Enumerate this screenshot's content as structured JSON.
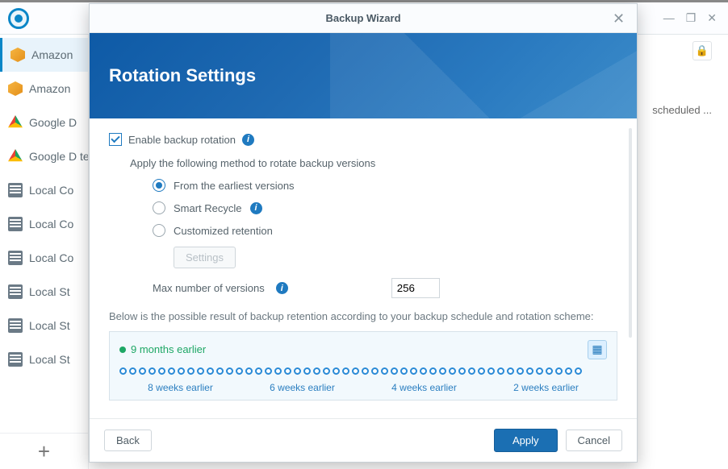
{
  "window": {
    "controls": {
      "min": "—",
      "max": "❐",
      "close": "✕"
    }
  },
  "sidebar": {
    "items": [
      {
        "label": "Amazon",
        "icon": "cube"
      },
      {
        "label": "Amazon",
        "icon": "cube"
      },
      {
        "label": "Google D",
        "icon": "drive"
      },
      {
        "label": "Google D test",
        "icon": "drive"
      },
      {
        "label": "Local Co",
        "icon": "db"
      },
      {
        "label": "Local Co",
        "icon": "db"
      },
      {
        "label": "Local Co",
        "icon": "db"
      },
      {
        "label": "Local St",
        "icon": "db"
      },
      {
        "label": "Local St",
        "icon": "db"
      },
      {
        "label": "Local St",
        "icon": "db"
      }
    ],
    "add_label": "+"
  },
  "panel": {
    "lock_glyph": "🔒",
    "scheduled_hint": "scheduled ..."
  },
  "modal": {
    "title": "Backup Wizard",
    "banner_title": "Rotation Settings",
    "enable_label": "Enable backup rotation",
    "apply_method_label": "Apply the following method to rotate backup versions",
    "radios": {
      "earliest": "From the earliest versions",
      "smart": "Smart Recycle",
      "custom": "Customized retention"
    },
    "settings_btn": "Settings",
    "max_versions_label": "Max number of versions",
    "max_versions_value": "256",
    "result_hint": "Below is the possible result of backup retention according to your backup schedule and rotation scheme:",
    "timeline": {
      "oldest_label": "9 months earlier",
      "cal_glyph": "▦",
      "labels": [
        "8 weeks earlier",
        "6 weeks earlier",
        "4 weeks earlier",
        "2 weeks earlier"
      ]
    },
    "footer": {
      "back": "Back",
      "apply": "Apply",
      "cancel": "Cancel"
    },
    "close_glyph": "✕",
    "info_glyph": "i"
  }
}
